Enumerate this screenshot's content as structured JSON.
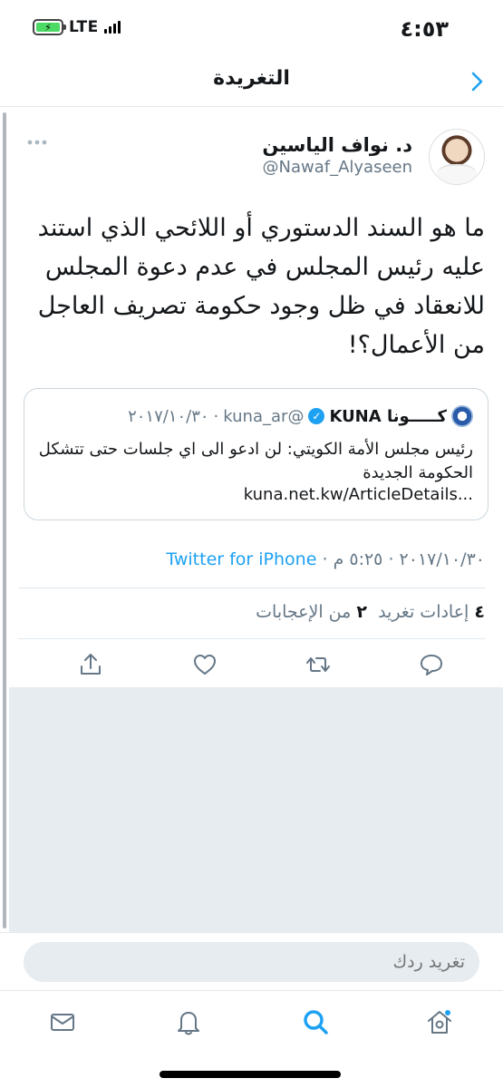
{
  "status": {
    "time": "٤:٥٣",
    "network": "LTE",
    "battery_percent": 100
  },
  "header": {
    "title": "التغريدة"
  },
  "tweet": {
    "author_name": "د. نواف الياسين",
    "author_handle": "@Nawaf_Alyaseen",
    "text": "ما هو السند الدستوري أو اللائحي الذي استند عليه رئيس المجلس في عدم دعوة المجلس للانعقاد في ظل وجود حكومة تصريف العاجل من الأعمال؟!",
    "quoted": {
      "name": "كـــــونا KUNA",
      "handle": "@kuna_ar",
      "date": "٢٠١٧/١٠/٣٠",
      "separator": "·",
      "text": "رئيس مجلس الأمة الكويتي: لن ادعو الى اي جلسات حتى تتشكل الحكومة الجديدة",
      "link": "kuna.net.kw/ArticleDetails..."
    },
    "meta": {
      "date": "٢٠١٧/١٠/٣٠",
      "time": "٥:٢٥ م",
      "separator": "·",
      "source": "Twitter for iPhone"
    },
    "stats": {
      "retweets_count": "٤",
      "retweets_label": "إعادات تغريد",
      "likes_count": "٢",
      "likes_label": "من الإعجابات"
    }
  },
  "reply": {
    "placeholder": "تغريد ردك"
  },
  "tabs": [
    "home-icon",
    "search-icon",
    "notifications-icon",
    "messages-icon"
  ],
  "colors": {
    "accent": "#1da1f2",
    "secondary_text": "#657786",
    "divider": "#e1e8ed",
    "background_gray": "#e6ecf0"
  }
}
